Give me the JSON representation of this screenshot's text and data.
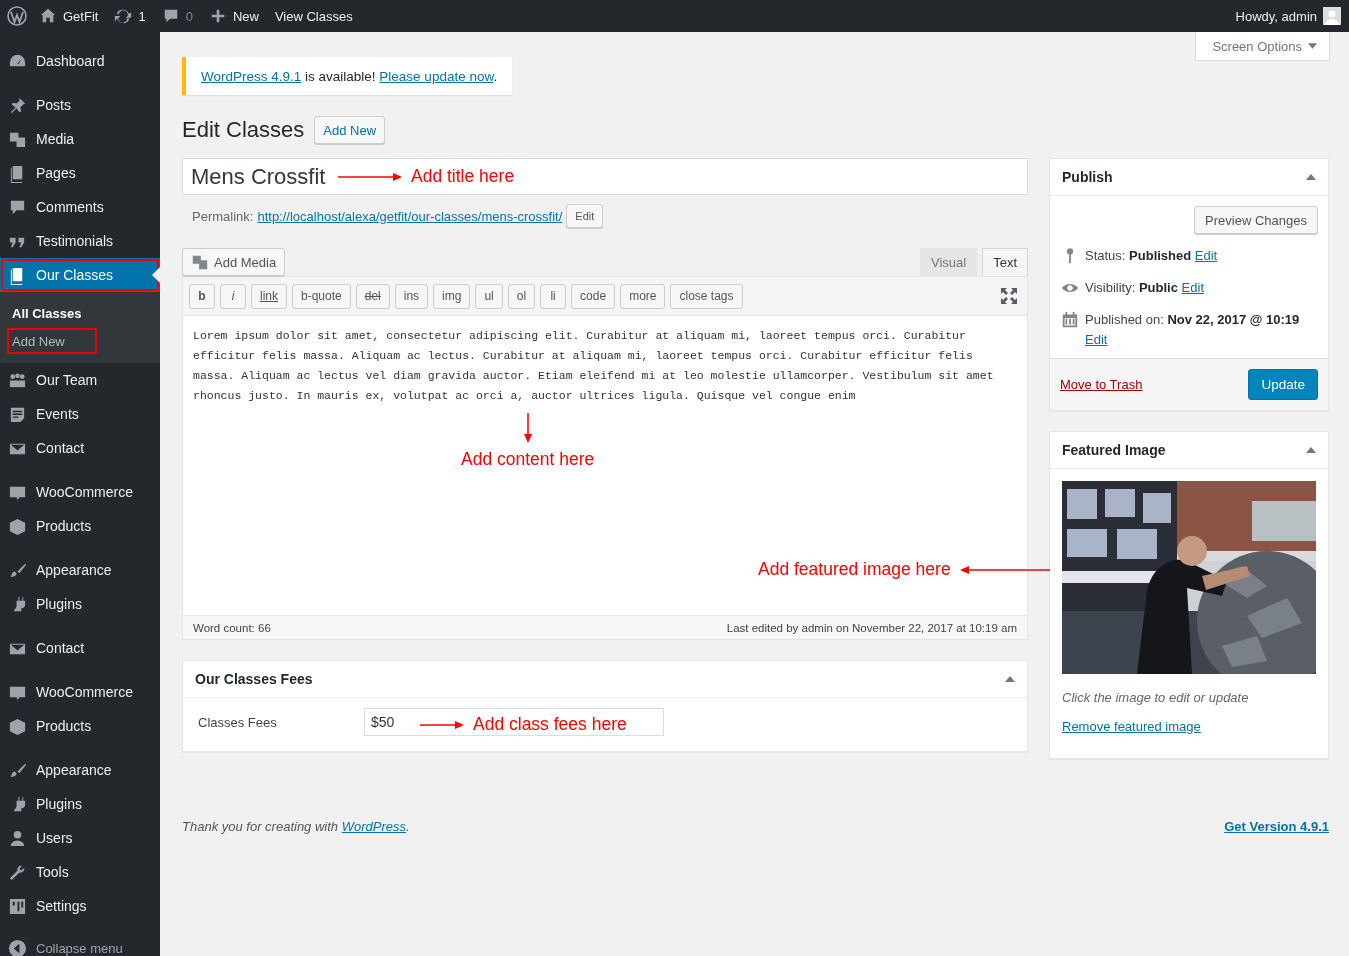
{
  "admin_bar": {
    "site": "GetFit",
    "updates": "1",
    "comments": "0",
    "new": "New",
    "view": "View Classes",
    "account": "Howdy, admin"
  },
  "sidebar": {
    "groups": [
      {
        "items": [
          {
            "label": "Dashboard",
            "selected": false,
            "outlined": false
          }
        ]
      },
      {
        "items": [
          {
            "label": "Posts",
            "selected": false,
            "outlined": false
          },
          {
            "label": "Media",
            "selected": false,
            "outlined": false
          },
          {
            "label": "Pages",
            "selected": false,
            "outlined": false
          },
          {
            "label": "Comments",
            "selected": false,
            "outlined": false
          },
          {
            "label": "Testimonials",
            "selected": false,
            "outlined": false
          },
          {
            "label": "Our Classes",
            "selected": true,
            "outlined": true,
            "children": [
              {
                "label": "All Classes",
                "selected": true,
                "outlined": false
              },
              {
                "label": "Add New",
                "selected": false,
                "outlined": true
              }
            ]
          },
          {
            "label": "Our Team",
            "selected": false,
            "outlined": false
          },
          {
            "label": "Events",
            "selected": false,
            "outlined": false
          },
          {
            "label": "Contact",
            "selected": false,
            "outlined": false
          }
        ]
      },
      {
        "items": [
          {
            "label": "WooCommerce",
            "selected": false,
            "outlined": false
          },
          {
            "label": "Products",
            "selected": false,
            "outlined": false
          }
        ]
      },
      {
        "items": [
          {
            "label": "Appearance",
            "selected": false,
            "outlined": false
          },
          {
            "label": "Plugins",
            "selected": false,
            "outlined": false
          }
        ]
      },
      {
        "items": [
          {
            "label": "Contact",
            "selected": false,
            "outlined": false
          }
        ]
      },
      {
        "items": [
          {
            "label": "WooCommerce",
            "selected": false,
            "outlined": false
          },
          {
            "label": "Products",
            "selected": false,
            "outlined": false
          }
        ]
      },
      {
        "items": [
          {
            "label": "Appearance",
            "selected": false,
            "outlined": false
          },
          {
            "label": "Plugins",
            "selected": false,
            "outlined": false
          },
          {
            "label": "Users",
            "selected": false,
            "outlined": false
          },
          {
            "label": "Tools",
            "selected": false,
            "outlined": false
          },
          {
            "label": "Settings",
            "selected": false,
            "outlined": false
          }
        ]
      }
    ],
    "collapse": "Collapse menu"
  },
  "screen_options": "Screen Options",
  "notice": {
    "link": "WordPress 4.9.1",
    "text": "is available!",
    "action": "Please update now",
    "end": "."
  },
  "page_title": "Edit Classes",
  "add_new": "Add New",
  "title_field": {
    "value": "Mens Crossfit"
  },
  "permalink": {
    "label": "Permalink:",
    "url": "http://localhost/alexa/getfit/our-classes/mens-crossfit/",
    "edit": "Edit"
  },
  "editor": {
    "add_media": "Add Media",
    "tabs": [
      {
        "label": "Visual",
        "selected": false
      },
      {
        "label": "Text",
        "selected": true
      }
    ],
    "quicktags": [
      {
        "label": "b",
        "kind": "bold"
      },
      {
        "label": "i",
        "kind": "italic"
      },
      {
        "label": "link",
        "kind": "underline"
      },
      {
        "label": "b-quote",
        "kind": "plain"
      },
      {
        "label": "del",
        "kind": "strike"
      },
      {
        "label": "ins",
        "kind": "plain"
      },
      {
        "label": "img",
        "kind": "plain"
      },
      {
        "label": "ul",
        "kind": "plain"
      },
      {
        "label": "ol",
        "kind": "plain"
      },
      {
        "label": "li",
        "kind": "plain"
      },
      {
        "label": "code",
        "kind": "plain"
      },
      {
        "label": "more",
        "kind": "plain"
      },
      {
        "label": "close tags",
        "kind": "plain"
      }
    ],
    "content": "Lorem ipsum dolor sit amet, consectetur adipiscing elit. Curabitur at aliquam mi, laoreet tempus orci. Curabitur efficitur felis massa. Aliquam ac lectus. Curabitur at aliquam mi, laoreet tempus orci. Curabitur efficitur felis massa. Aliquam ac lectus vel diam gravida auctor. Etiam eleifend mi at leo molestie ullamcorper. Vestibulum sit amet rhoncus justo. In mauris ex, volutpat ac orci a, auctor ultrices ligula. Quisque vel congue enim",
    "word_count": "Word count: 66",
    "last_edited": "Last edited by admin on November 22, 2017 at 10:19 am"
  },
  "fees_box": {
    "title": "Our Classes Fees",
    "expanded": true,
    "label": "Classes Fees",
    "value": "$50"
  },
  "publish": {
    "title": "Publish",
    "expanded": true,
    "preview": "Preview Changes",
    "rows": [
      {
        "label": "Status:",
        "value": "Published",
        "edit": "Edit"
      },
      {
        "label": "Visibility:",
        "value": "Public",
        "edit": "Edit"
      },
      {
        "label": "Published on:",
        "value": "Nov 22, 2017 @ 10:19",
        "edit": "Edit"
      }
    ],
    "trash": "Move to Trash",
    "update": "Update"
  },
  "featured": {
    "title": "Featured Image",
    "expanded": true,
    "caption": "Click the image to edit or update",
    "remove": "Remove featured image"
  },
  "annotations": {
    "title": "Add title here",
    "content": "Add content here",
    "featured": "Add featured image here",
    "fees": "Add class fees here"
  },
  "footer": {
    "thanks": "Thank you for creating with",
    "link": "WordPress",
    "end": ".",
    "version": "Get Version 4.9.1"
  }
}
